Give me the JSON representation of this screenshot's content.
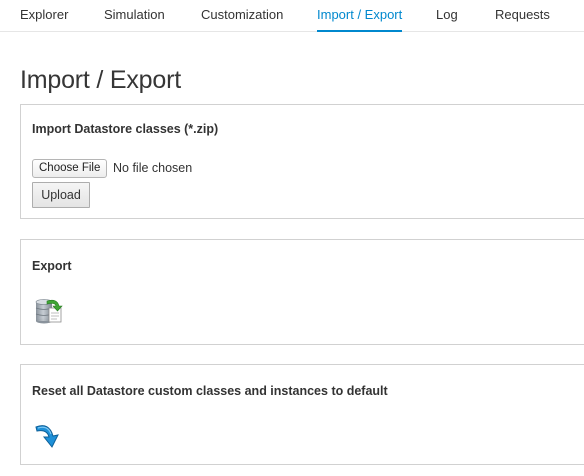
{
  "nav": {
    "tabs": [
      {
        "label": "Explorer"
      },
      {
        "label": "Simulation"
      },
      {
        "label": "Customization"
      },
      {
        "label": "Import / Export",
        "active": true
      },
      {
        "label": "Log"
      },
      {
        "label": "Requests"
      }
    ]
  },
  "page": {
    "title": "Import / Export"
  },
  "import_panel": {
    "heading": "Import Datastore classes (*.zip)",
    "choose_file_label": "Choose File",
    "file_status": "No file chosen",
    "upload_label": "Upload"
  },
  "export_panel": {
    "heading": "Export",
    "icon": "database-export-icon"
  },
  "reset_panel": {
    "heading": "Reset all Datastore custom classes and instances to default",
    "icon": "reset-arrow-icon"
  },
  "colors": {
    "accent": "#0088ce",
    "panel_border": "#d1d1d1",
    "title": "#363636"
  }
}
